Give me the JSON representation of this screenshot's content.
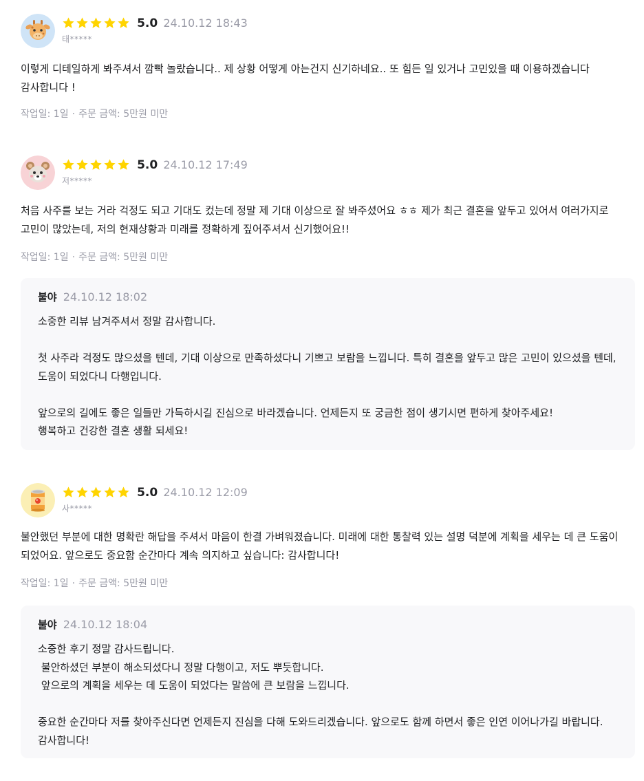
{
  "colors": {
    "star": "#FFD400",
    "muted": "#9a9ba7",
    "text": "#212224",
    "reply_bg": "#f8f8fa"
  },
  "reviews": [
    {
      "avatar_icon": "giraffe-avatar",
      "rating": 5,
      "score": "5.0",
      "date": "24.10.12 18:43",
      "user": "태*****",
      "body": "이렇게 디테일하게 봐주셔서 깜빡 놀랐습니다.. 제 상황 어떻게 아는건지 신기하네요.. 또 힘든 일 있거나 고민있을 때 이용하겠습니다 감사합니다 !",
      "work_days": "작업일: 1일",
      "order_amount": "주문 금액: 5만원 미만"
    },
    {
      "avatar_icon": "bear-avatar",
      "rating": 5,
      "score": "5.0",
      "date": "24.10.12 17:49",
      "user": "저*****",
      "body": "처음 사주를 보는 거라 걱정도 되고 기대도 컸는데 정말 제 기대 이상으로 잘 봐주셨어요 ㅎㅎ 제가 최근 결혼을 앞두고 있어서 여러가지로 고민이 많았는데, 저의 현재상황과 미래를 정확하게 짚어주셔서 신기했어요!!",
      "work_days": "작업일: 1일",
      "order_amount": "주문 금액: 5만원 미만",
      "reply": {
        "name": "불야",
        "date": "24.10.12 18:02",
        "body": "소중한 리뷰 남겨주셔서 정말 감사합니다.\n\n첫 사주라 걱정도 많으셨을 텐데, 기대 이상으로 만족하셨다니 기쁘고 보람을 느낍니다. 특히 결혼을 앞두고 많은 고민이 있으셨을 텐데, 도움이 되었다니 다행입니다.\n\n앞으로의 길에도 좋은 일들만 가득하시길 진심으로 바라겠습니다. 언제든지 또 궁금한 점이 생기시면 편하게 찾아주세요!\n행복하고 건강한 결혼 생활 되세요!"
      }
    },
    {
      "avatar_icon": "can-avatar",
      "rating": 5,
      "score": "5.0",
      "date": "24.10.12 12:09",
      "user": "사*****",
      "body": "불안했던 부분에 대한 명확란 해답을 주셔서 마음이 한결 가벼워졌습니다. 미래에 대한 통찰력 있는 설명 덕분에 계획을 세우는 데 큰 도움이 되었어요. 앞으로도 중요함 순간마다 계속 의지하고 싶습니다: 감사합니다!",
      "work_days": "작업일: 1일",
      "order_amount": "주문 금액: 5만원 미만",
      "reply": {
        "name": "불야",
        "date": "24.10.12 18:04",
        "body": "소중한 후기 정말 감사드립니다.\n 불안하셨던 부분이 해소되셨다니 정말 다행이고, 저도 뿌듯합니다.\n 앞으로의 계획을 세우는 데 도움이 되었다는 말씀에 큰 보람을 느낍니다.\n\n중요한 순간마다 저를 찾아주신다면 언제든지 진심을 다해 도와드리겠습니다. 앞으로도 함께 하면서 좋은 인연 이어나가길 바랍니다. 감사합니다!"
      }
    }
  ]
}
